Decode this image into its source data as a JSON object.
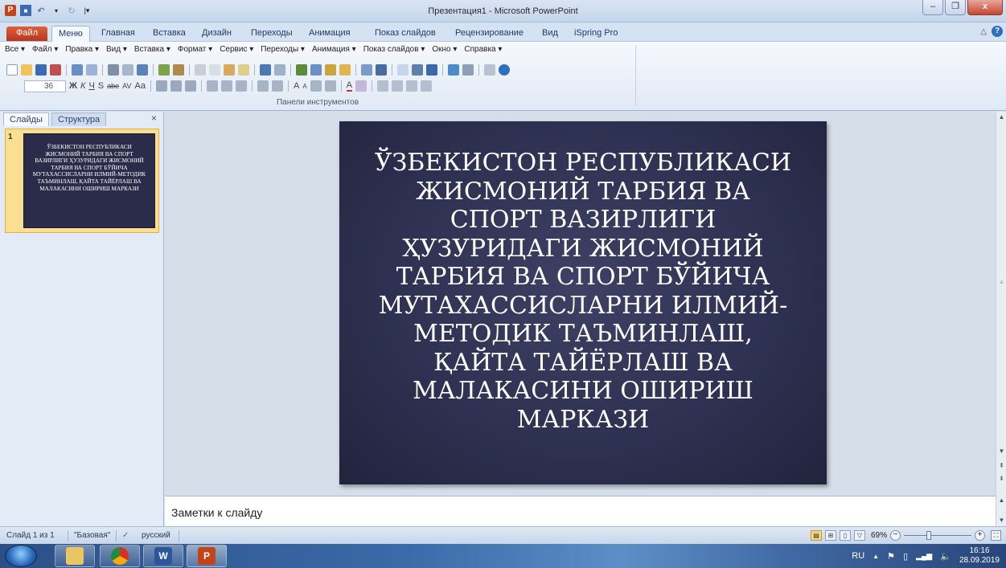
{
  "window": {
    "title": "Презентация1  -  Microsoft PowerPoint",
    "minimize_symbol": "–",
    "maximize_symbol": "❐",
    "close_symbol": "x"
  },
  "ribbon_tabs": [
    "Файл",
    "Меню",
    "Главная",
    "Вставка",
    "Дизайн",
    "Переходы",
    "Анимация",
    "Показ слайдов",
    "Рецензирование",
    "Вид",
    "iSpring Pro"
  ],
  "active_tab": "Меню",
  "classic_menu": [
    "Все ▾",
    "Файл ▾",
    "Правка ▾",
    "Вид ▾",
    "Вставка ▾",
    "Формат ▾",
    "Сервис ▾",
    "Переходы ▾",
    "Анимация ▾",
    "Показ слайдов ▾",
    "Окно ▾",
    "Справка ▾"
  ],
  "toolbar": {
    "font_size": "36",
    "bold": "Ж",
    "italic": "К",
    "underline": "Ч",
    "strike": "S",
    "abc": "abe",
    "spacing": "AV",
    "case": "Aa",
    "grow": "A",
    "shrink": "A",
    "font_color": "A",
    "group_label": "Панели инструментов"
  },
  "left_pane": {
    "tabs": [
      "Слайды",
      "Структура"
    ],
    "close_symbol": "×",
    "slide_number": "1",
    "thumb_text": "ЎЗБЕКИСТОН РЕСПУБЛИКАСИ ЖИСМОНИЙ ТАРБИЯ ВА СПОРТ ВАЗИРЛИГИ ҲУЗУРИДАГИ ЖИСМОНИЙ ТАРБИЯ ВА СПОРТ БЎЙИЧА МУТАХАССИСЛАРНИ ИЛМИЙ-МЕТОДИК ТАЪМИНЛАШ, ҚАЙТА ТАЙЁРЛАШ ВА МАЛАКАСИНИ ОШИРИШ МАРКАЗИ"
  },
  "slide": {
    "title": "ЎЗБЕКИСТОН РЕСПУБЛИКАСИ\nЖИСМОНИЙ ТАРБИЯ ВА\nСПОРТ ВАЗИРЛИГИ\nҲУЗУРИДАГИ  ЖИСМОНИЙ\nТАРБИЯ ВА СПОРТ БЎЙИЧА\nМУТАХАССИСЛАРНИ ИЛМИЙ-\nМЕТОДИК ТАЪМИНЛАШ,\nҚАЙТА ТАЙЁРЛАШ ВА\nМАЛАКАСИНИ ОШИРИШ\nМАРКАЗИ"
  },
  "notes": {
    "placeholder": "Заметки к слайду"
  },
  "status": {
    "slide_info": "Слайд 1 из 1",
    "theme": "\"Базовая\"",
    "language": "русский",
    "zoom": "69%"
  },
  "taskbar": {
    "lang": "RU",
    "time": "16:16",
    "date": "28.09.2019",
    "apps": [
      "W",
      "P"
    ]
  },
  "colors": {
    "slide_bg": "#2f3152",
    "file_tab": "#c4441a",
    "accent": "#2b579a"
  }
}
